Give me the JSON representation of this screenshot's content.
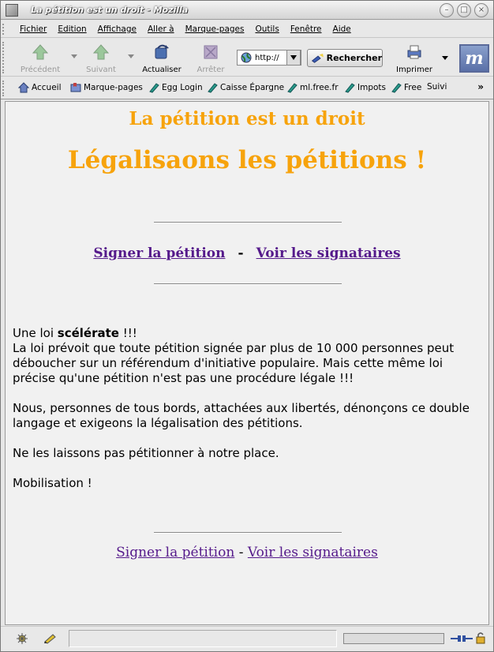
{
  "window": {
    "title": "La pétition est un droit - Mozilla"
  },
  "menu": [
    "Fichier",
    "Edition",
    "Affichage",
    "Aller à",
    "Marque-pages",
    "Outils",
    "Fenêtre",
    "Aide"
  ],
  "nav": {
    "back": "Précédent",
    "forward": "Suivant",
    "reload": "Actualiser",
    "stop": "Arrêter",
    "url": "http://",
    "search": "Rechercher",
    "print": "Imprimer",
    "logo": "m"
  },
  "bookmarks": [
    "Accueil",
    "Marque-pages",
    "Egg Login",
    "Caisse Épargne",
    "ml.free.fr",
    "Impots",
    "Free",
    "Suivi"
  ],
  "page": {
    "subtitle": "La pétition est un droit",
    "headline": "Légalisaons les pétitions !",
    "link_sign": "Signer la pétition",
    "link_sep": "-",
    "link_view": "Voir les signataires",
    "para1_prefix": "Une loi ",
    "para1_bold": "scélérate",
    "para1_suffix": " !!!",
    "para1_rest": "La loi prévoit que toute pétition signée par plus de 10 000 personnes peut déboucher sur un référendum d'initiative populaire. Mais cette même loi précise qu'une pétition n'est pas une procédure légale !!!",
    "para2": "Nous, personnes de tous bords, attachées aux libertés, dénonçons ce double langage et exigeons la légalisation des pétitions.",
    "para3": "Ne les laissons pas pétitionner à notre place.",
    "para4": "Mobilisation !"
  },
  "colors": {
    "heading": "#f7a30c",
    "visited_link": "#551a8b",
    "page_bg": "#f1f1f1"
  }
}
